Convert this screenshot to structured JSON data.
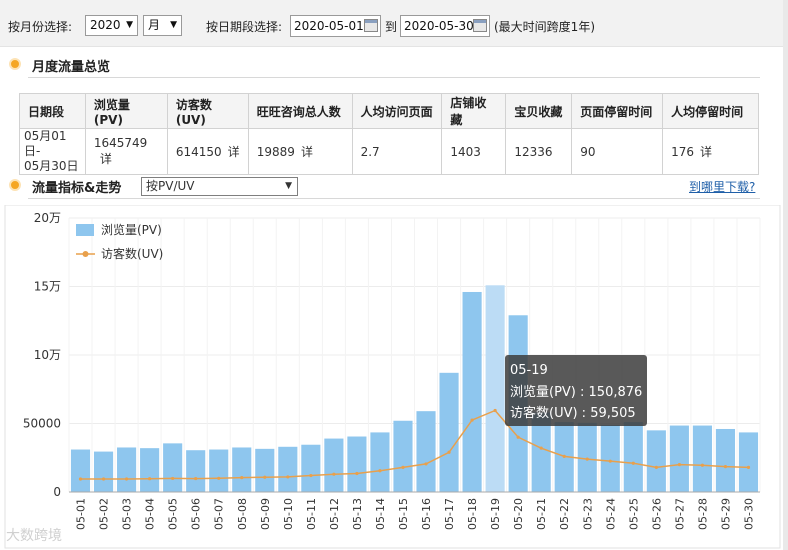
{
  "filters": {
    "month_label": "按月份选择:",
    "year_value": "2020",
    "month_value": "月",
    "date_label": "按日期段选择:",
    "start_date": "2020-05-01",
    "to_label": "到",
    "end_date": "2020-05-30",
    "span_note": "(最大时间跨度1年)"
  },
  "overview": {
    "title": "月度流量总览",
    "headers": [
      "日期段",
      "浏览量(PV)",
      "访客数(UV)",
      "旺旺咨询总人数",
      "人均访问页面",
      "店铺收藏",
      "宝贝收藏",
      "页面停留时间",
      "人均停留时间"
    ],
    "row": {
      "date_line1": "05月01日-",
      "date_line2": "05月30日",
      "pv": "1645749",
      "uv": "614150",
      "ww": "19889",
      "pages_per_user": "2.7",
      "shop_fav": "1403",
      "item_fav": "12336",
      "page_stay": "90",
      "avg_stay": "176"
    },
    "detail_label": "详"
  },
  "trend": {
    "title": "流量指标&走势",
    "metric_select": "按PV/UV",
    "download_link": "到哪里下载?"
  },
  "chart_data": {
    "type": "bar",
    "categories": [
      "05-01",
      "05-02",
      "05-03",
      "05-04",
      "05-05",
      "05-06",
      "05-07",
      "05-08",
      "05-09",
      "05-10",
      "05-11",
      "05-12",
      "05-13",
      "05-14",
      "05-15",
      "05-16",
      "05-17",
      "05-18",
      "05-19",
      "05-20",
      "05-21",
      "05-22",
      "05-23",
      "05-24",
      "05-25",
      "05-26",
      "05-27",
      "05-28",
      "05-29",
      "05-30"
    ],
    "series": [
      {
        "name": "浏览量(PV)",
        "type": "bar",
        "color": "#8ec6ee",
        "values": [
          31000,
          29500,
          32500,
          32000,
          35500,
          30500,
          31000,
          32500,
          31500,
          33000,
          34500,
          39000,
          40500,
          43500,
          52000,
          59000,
          87000,
          146000,
          150876,
          129000,
          58000,
          51000,
          50500,
          49000,
          51000,
          45000,
          48500,
          48500,
          46000,
          43500
        ]
      },
      {
        "name": "访客数(UV)",
        "type": "line",
        "color": "#e8a04c",
        "values": [
          9500,
          9500,
          9500,
          9700,
          9900,
          9800,
          10000,
          10500,
          10800,
          11000,
          12000,
          13000,
          13500,
          15500,
          18000,
          20500,
          29000,
          52500,
          59505,
          40000,
          32000,
          26000,
          24000,
          22500,
          21000,
          18000,
          20000,
          19500,
          18500,
          18000
        ]
      }
    ],
    "y_ticks": [
      {
        "value": 0,
        "label": "0"
      },
      {
        "value": 50000,
        "label": "50000"
      },
      {
        "value": 100000,
        "label": "10万"
      },
      {
        "value": 150000,
        "label": "15万"
      },
      {
        "value": 200000,
        "label": "20万"
      }
    ],
    "ylim": [
      0,
      200000
    ],
    "highlight_index": 18,
    "tooltip": {
      "date": "05-19",
      "pv_text": "浏览量(PV) : 150,876",
      "uv_text": "访客数(UV) : 59,505"
    },
    "legend_position": "top-left",
    "grid": true
  },
  "watermark": "大数跨境"
}
